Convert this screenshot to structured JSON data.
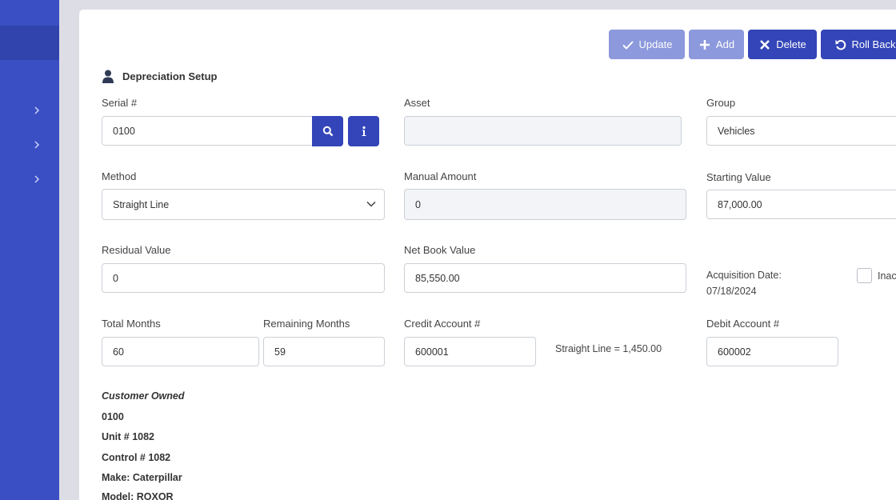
{
  "toolbar": {
    "update_label": "Update",
    "add_label": "Add",
    "delete_label": "Delete",
    "rollback_label": "Roll Back"
  },
  "section": {
    "title": "Depreciation Setup"
  },
  "fields": {
    "serial": {
      "label": "Serial #",
      "value": "0100"
    },
    "asset": {
      "label": "Asset",
      "value": ""
    },
    "group": {
      "label": "Group",
      "value": "Vehicles"
    },
    "method": {
      "label": "Method",
      "value": "Straight Line"
    },
    "manual_amount": {
      "label": "Manual Amount",
      "value": "0"
    },
    "starting_value": {
      "label": "Starting Value",
      "value": "87,000.00"
    },
    "residual_value": {
      "label": "Residual Value",
      "value": "0"
    },
    "net_book_value": {
      "label": "Net Book Value",
      "value": "85,550.00"
    },
    "total_months": {
      "label": "Total Months",
      "value": "60"
    },
    "remaining_months": {
      "label": "Remaining Months",
      "value": "59"
    },
    "credit_account": {
      "label": "Credit Account #",
      "value": "600001"
    },
    "debit_account": {
      "label": "Debit Account #",
      "value": "600002"
    }
  },
  "acquisition": {
    "label": "Acquisition Date:",
    "value": "07/18/2024"
  },
  "inactive": {
    "label": "Inac",
    "checked": false
  },
  "straight_line_text": "Straight Line = 1,450.00",
  "asset_info": {
    "owner": "Customer Owned",
    "serial": "0100",
    "unit": "Unit # 1082",
    "control": "Control # 1082",
    "make": "Make: Caterpillar",
    "model": "Model: ROXOR"
  },
  "icons": {
    "search": "search-icon",
    "info": "info-icon",
    "user": "user-icon",
    "chevron": "chevron-right-icon"
  },
  "colors": {
    "primary": "#3345b8",
    "primary_disabled": "#8c99dc",
    "sidebar": "#3a4fc4"
  }
}
